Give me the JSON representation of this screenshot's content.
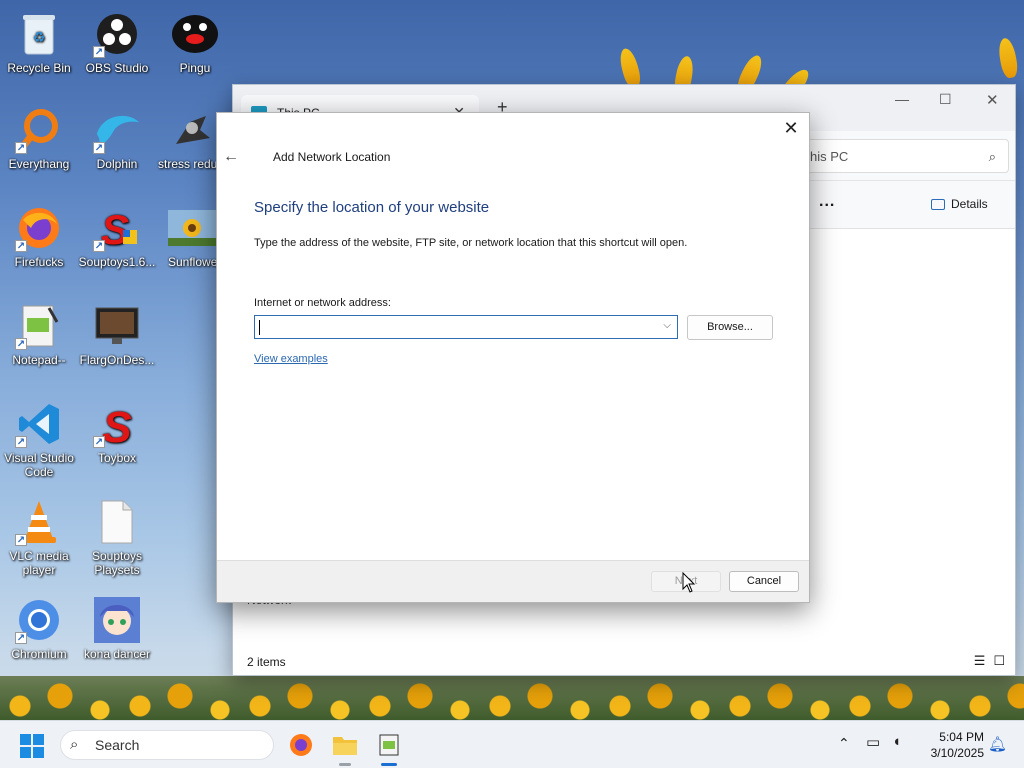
{
  "desktop": {
    "icons": [
      {
        "label": "Recycle Bin"
      },
      {
        "label": "OBS Studio"
      },
      {
        "label": "Pingu"
      },
      {
        "label": "Everythang"
      },
      {
        "label": "Dolphin"
      },
      {
        "label": "stress redu"
      },
      {
        "label": "Firefucks"
      },
      {
        "label": "Souptoys1.6..."
      },
      {
        "label": "Sunflower"
      },
      {
        "label": "Notepad--"
      },
      {
        "label": "FlargOnDes..."
      },
      {
        "label": "Visual Studio Code"
      },
      {
        "label": "Toybox"
      },
      {
        "label": "VLC media player"
      },
      {
        "label": "Souptoys Playsets"
      },
      {
        "label": "Chromium"
      },
      {
        "label": "kona dancer"
      }
    ]
  },
  "explorer": {
    "tab_title": "This PC",
    "tab_close": "✕",
    "new_tab": "+",
    "minimize": "—",
    "maximize": "☐",
    "close": "✕",
    "search_text": "his PC",
    "more": "...",
    "details_label": "Details",
    "network_label": "Network",
    "status_items": "2 items"
  },
  "dialog": {
    "title": "Add Network Location",
    "close": "✕",
    "back": "←",
    "heading": "Specify the location of your website",
    "description": "Type the address of the website, FTP site, or network location that this shortcut will open.",
    "field_label": "Internet or network address:",
    "field_value": "",
    "dropdown_glyph": "⌵",
    "browse_label": "Browse...",
    "examples_link": "View examples",
    "next_label": "Next",
    "cancel_label": "Cancel"
  },
  "taskbar": {
    "search_placeholder": "Search",
    "time": "5:04 PM",
    "date": "3/10/2025"
  }
}
